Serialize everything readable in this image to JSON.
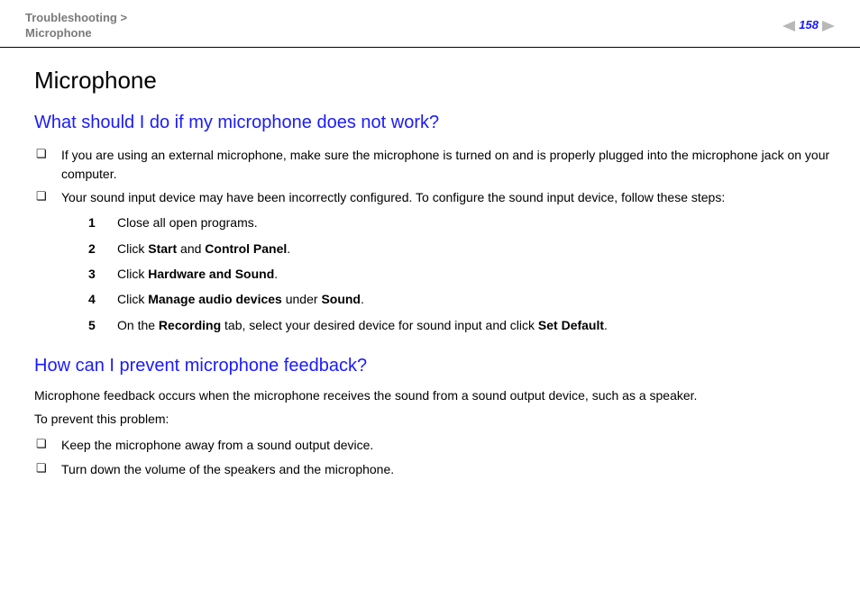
{
  "header": {
    "breadcrumb_top": "Troubleshooting",
    "breadcrumb_sep": ">",
    "breadcrumb_bottom": "Microphone",
    "page_number": "158"
  },
  "doc": {
    "title": "Microphone",
    "section1": {
      "heading": "What should I do if my microphone does not work?",
      "bullet1": "If you are using an external microphone, make sure the microphone is turned on and is properly plugged into the microphone jack on your computer.",
      "bullet2": "Your sound input device may have been incorrectly configured. To configure the sound input device, follow these steps:",
      "steps": {
        "s1": "Close all open programs.",
        "s2a": "Click ",
        "s2b": "Start",
        "s2c": " and ",
        "s2d": "Control Panel",
        "s2e": ".",
        "s3a": "Click ",
        "s3b": "Hardware and Sound",
        "s3c": ".",
        "s4a": "Click ",
        "s4b": "Manage audio devices",
        "s4c": " under ",
        "s4d": "Sound",
        "s4e": ".",
        "s5a": "On the ",
        "s5b": "Recording",
        "s5c": " tab, select your desired device for sound input and click ",
        "s5d": "Set Default",
        "s5e": "."
      }
    },
    "section2": {
      "heading": "How can I prevent microphone feedback?",
      "p1": "Microphone feedback occurs when the microphone receives the sound from a sound output device, such as a speaker.",
      "p2": "To prevent this problem:",
      "bullet1": "Keep the microphone away from a sound output device.",
      "bullet2": "Turn down the volume of the speakers and the microphone."
    }
  }
}
